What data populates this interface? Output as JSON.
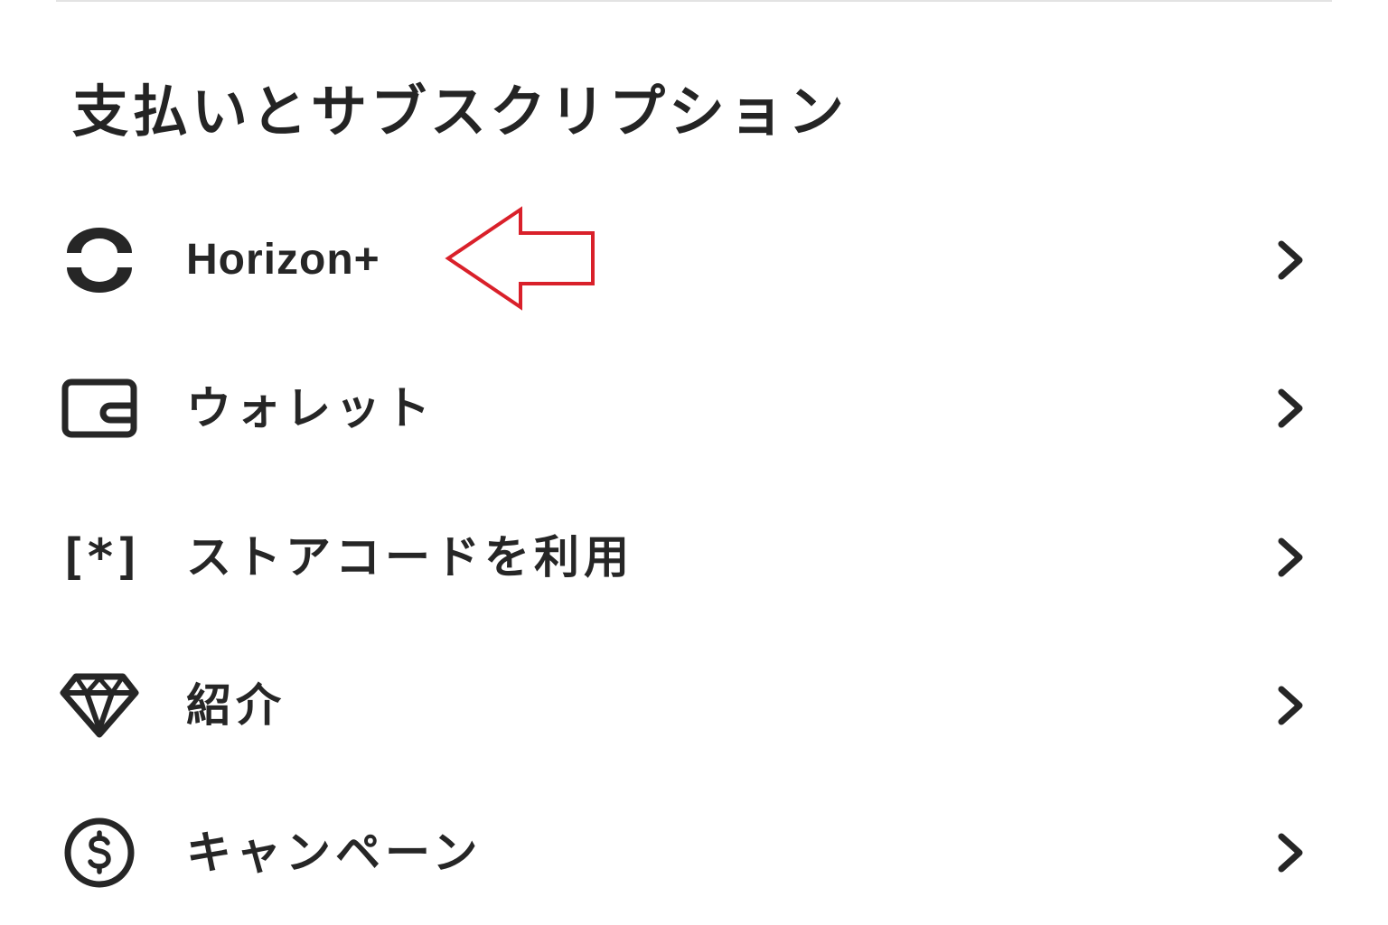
{
  "section": {
    "title": "支払いとサブスクリプション"
  },
  "menu": {
    "items": [
      {
        "label": "Horizon+",
        "icon": "horizon-ring-icon"
      },
      {
        "label": "ウォレット",
        "icon": "wallet-icon"
      },
      {
        "label": "ストアコードを利用",
        "icon": "store-code-icon",
        "icon_text": "[*]"
      },
      {
        "label": "紹介",
        "icon": "diamond-icon"
      },
      {
        "label": "キャンペーン",
        "icon": "dollar-coin-icon"
      }
    ]
  },
  "annotation": {
    "arrow_color": "#d9202a",
    "target": "Horizon+"
  },
  "colors": {
    "text": "#262626",
    "divider": "#e3e3e3",
    "background": "#ffffff"
  }
}
